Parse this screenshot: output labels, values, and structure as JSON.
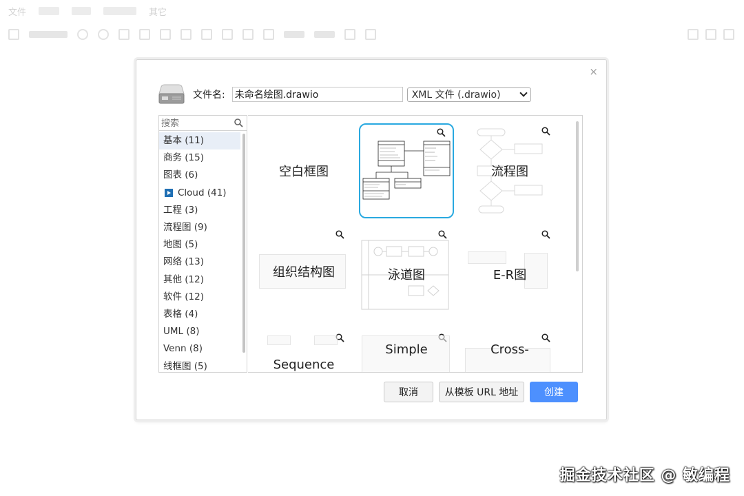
{
  "app": {
    "menu": {
      "file": "文件",
      "other": "其它"
    }
  },
  "dialog": {
    "close": "×",
    "filename_label": "文件名:",
    "filename_value": "未命名绘图.drawio",
    "format": "XML 文件 (.drawio)",
    "search_placeholder": "搜索",
    "categories": [
      "基本 (11)",
      "商务 (15)",
      "图表 (6)",
      "Cloud (41)",
      "工程 (3)",
      "流程图 (9)",
      "地图 (5)",
      "网络 (13)",
      "其他 (12)",
      "软件 (12)",
      "表格 (4)",
      "UML (8)",
      "Venn (8)",
      "线框图 (5)"
    ],
    "templates": [
      {
        "label": "空白框图"
      },
      {
        "label": ""
      },
      {
        "label": "流程图"
      },
      {
        "label": "组织结构图"
      },
      {
        "label": "泳道图"
      },
      {
        "label": "E-R图"
      },
      {
        "label": "Sequence"
      },
      {
        "label": "Simple"
      },
      {
        "label": "Cross-"
      }
    ],
    "buttons": {
      "cancel": "取消",
      "from_url": "从模板 URL 地址",
      "create": "创建"
    }
  },
  "watermark": "掘金技术社区 @ 敏编程",
  "colors": {
    "primary": "#4d90fe",
    "selected_border": "#29a9e0",
    "selected_row": "#e8eef7"
  }
}
